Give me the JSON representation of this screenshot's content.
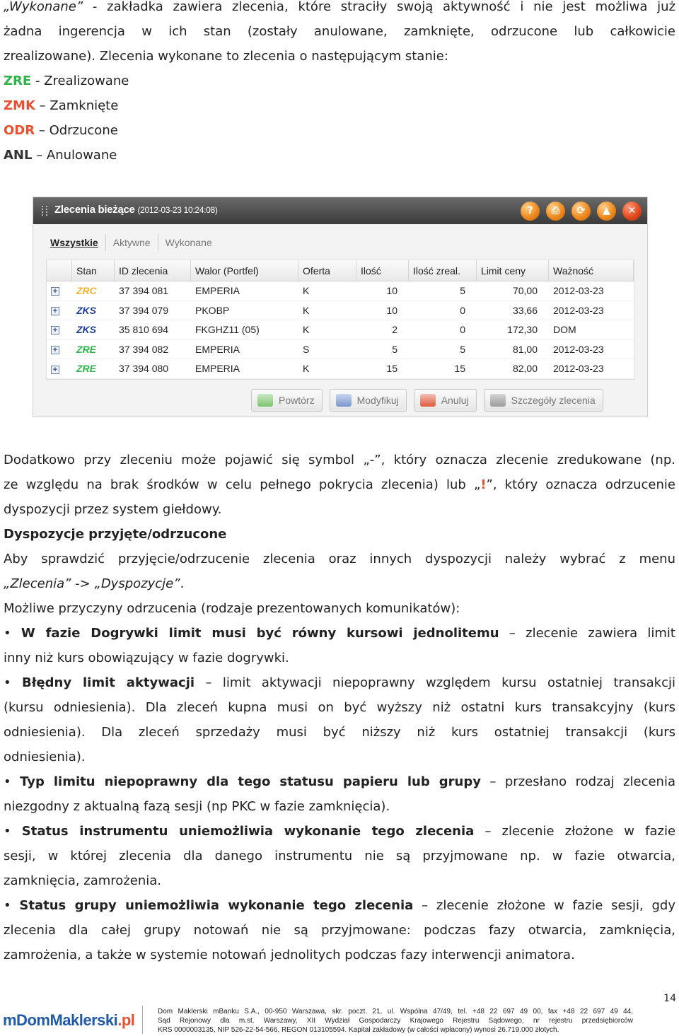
{
  "intro": {
    "l1_a": "„Wykonane”",
    "l1_b": " - zakładka zawiera zlecenia, które straciły swoją aktywność i nie jest możliwa już",
    "l2": "żadna ingerencja w ich stan (zostały anulowane, zamknięte, odrzucone lub całkowicie",
    "l3": "zrealizowane). Zlecenia wykonane to zlecenia o następującym stanie:"
  },
  "statuses": [
    {
      "code": "ZRE",
      "sep": " - ",
      "label": "Zrealizowane"
    },
    {
      "code": "ZMK",
      "sep": " – ",
      "label": "Zamknięte"
    },
    {
      "code": "ODR",
      "sep": " – ",
      "label": "Odrzucone"
    },
    {
      "code": "ANL",
      "sep": " – ",
      "label": "Anulowane"
    }
  ],
  "colors": {
    "green": "#2fb34a",
    "red": "#e8502f",
    "orange": "#f08a1e",
    "navy": "#1d3f9a"
  },
  "widget": {
    "title": "Zlecenia bieżące",
    "timestamp": "(2012-03-23 10:24:08)",
    "title_icons": [
      "help-icon",
      "print-icon",
      "refresh-icon",
      "collapse-icon",
      "close-icon"
    ],
    "tabs": [
      "Wszystkie",
      "Aktywne",
      "Wykonane"
    ],
    "columns": [
      "Stan",
      "ID zlecenia",
      "Walor (Portfel)",
      "Oferta",
      "Ilość",
      "Ilość zreal.",
      "Limit ceny",
      "Ważność"
    ],
    "rows": [
      {
        "stan": "ZRC",
        "id": "37 394 081",
        "walor": "EMPERIA",
        "oferta": "K",
        "ilosc": "10",
        "zreal": "5",
        "limit": "70,00",
        "waznosc": "2012-03-23"
      },
      {
        "stan": "ZKS",
        "id": "37 394 079",
        "walor": "PKOBP",
        "oferta": "K",
        "ilosc": "10",
        "zreal": "0",
        "limit": "33,66",
        "waznosc": "2012-03-23"
      },
      {
        "stan": "ZKS",
        "id": "35 810 694",
        "walor": "FKGHZ11 (05)",
        "oferta": "K",
        "ilosc": "2",
        "zreal": "0",
        "limit": "172,30",
        "waznosc": "DOM"
      },
      {
        "stan": "ZRE",
        "id": "37 394 082",
        "walor": "EMPERIA",
        "oferta": "S",
        "ilosc": "5",
        "zreal": "5",
        "limit": "81,00",
        "waznosc": "2012-03-23"
      },
      {
        "stan": "ZRE",
        "id": "37 394 080",
        "walor": "EMPERIA",
        "oferta": "K",
        "ilosc": "15",
        "zreal": "15",
        "limit": "82,00",
        "waznosc": "2012-03-23"
      }
    ],
    "actions": [
      "Powtórz",
      "Modyfikuj",
      "Anuluj",
      "Szczegóły zlecenia"
    ]
  },
  "para2": {
    "l1": "Dodatkowo przy zleceniu może pojawić się symbol „-”, który oznacza zlecenie zredukowane (np.",
    "l2_a": "ze względu na brak środków w celu pełnego pokrycia zlecenia) lub „",
    "l2_b": "!",
    "l2_c": "”, który oznacza odrzucenie",
    "l3": "dyspozycji przez system giełdowy."
  },
  "section": {
    "heading": "Dyspozycje przyjęte/odrzucone",
    "p1_l1": "Aby sprawdzić przyjęcie/odrzucenie zlecenia oraz innych dyspozycji należy wybrać z menu",
    "p1_l2_a": "„Zlecenia”",
    "p1_l2_b": " -> ",
    "p1_l2_c": "„Dyspozycje”",
    "p1_l2_d": ".",
    "reasons_intro": "Możliwe przyczyny odrzucenia (rodzaje prezentowanych komunikatów):"
  },
  "bullets": {
    "b1_bold": "W fazie Dogrywki limit musi być równy kursowi jednolitemu",
    "b1_rest": " – zlecenie zawiera limit",
    "b1_l2": "inny niż kurs obowiązujący w fazie dogrywki.",
    "b2_bold": "Błędny limit aktywacji",
    "b2_rest": " – limit aktywacji niepoprawny względem kursu ostatniej transakcji",
    "b2_l2": "(kursu odniesienia). Dla zleceń kupna musi on być wyższy niż ostatni kurs transakcyjny (kurs",
    "b2_l3": "odniesienia). Dla zleceń sprzedaży musi być niższy niż kurs ostatniej transakcji (kurs",
    "b2_l4": "odniesienia).",
    "b3_bold": "Typ limitu niepoprawny dla tego statusu papieru lub grupy",
    "b3_rest": " – przesłano rodzaj zlecenia",
    "b3_l2": "niezgodny z aktualną fazą sesji (np PKC w fazie zamknięcia).",
    "b4_bold": "Status instrumentu uniemożliwia wykonanie tego zlecenia",
    "b4_rest": " – zlecenie złożone w fazie",
    "b4_l2": "sesji, w której zlecenia dla danego instrumentu nie są przyjmowane np. w fazie otwarcia,",
    "b4_l3": "zamknięcia, zamrożenia.",
    "b5_bold": "Status grupy uniemożliwia wykonanie tego zlecenia",
    "b5_rest": " – zlecenie złożone w fazie sesji, gdy",
    "b5_l2": "zlecenia dla całej grupy notowań nie są przyjmowane: podczas fazy otwarcia, zamknięcia,",
    "b5_l3": "zamrożenia, a także w systemie notowań jednolitych podczas fazy interwencji animatora."
  },
  "footer": {
    "page": "14",
    "logo_main": "mDomMaklerski",
    "logo_tld": ".pl",
    "l1": "Dom Maklerski mBanku S.A., 00-950 Warszawa, skr. poczt. 21, ul. Wspólna 47/49, tel. +48 22 697 49 00, fax +48 22 697 49 44,",
    "l2": "Sąd Rejonowy dla m.st. Warszawy, XII Wydział Gospodarczy Krajowego Rejestru Sądowego, nr rejestru przedsiębiorców",
    "l3": "KRS 0000003135, NIP 526-22-54-566, REGON 013105594. Kapitał zakładowy (w całości wpłacony) wynosi 26.719.000 złotych."
  }
}
